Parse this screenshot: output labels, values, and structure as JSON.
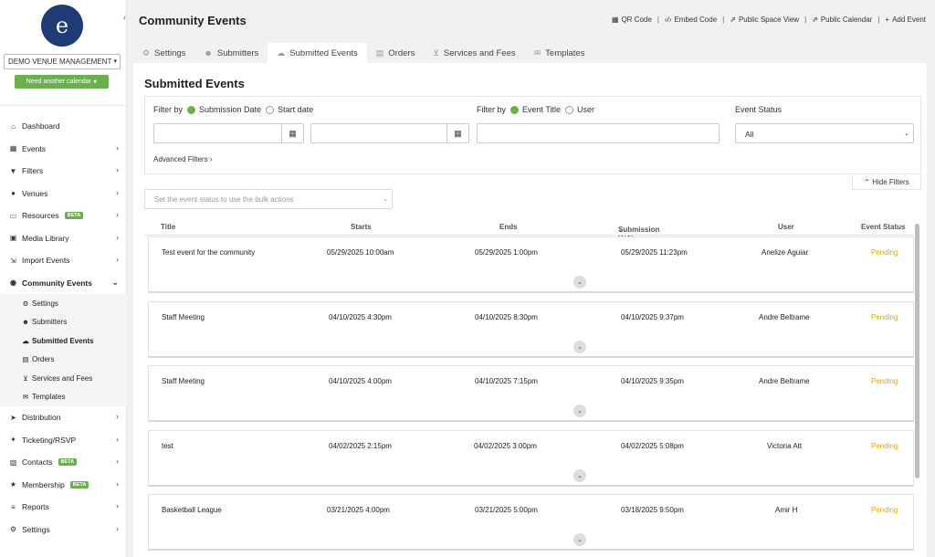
{
  "sidebar": {
    "logo_glyph": "e",
    "venue_select": "DEMO VENUE MANAGEMENT",
    "need_calendar": "Need another calendar",
    "items": [
      {
        "label": "Dashboard",
        "icon": "home-icon",
        "glyph": "⌂"
      },
      {
        "label": "Events",
        "icon": "calendar-icon",
        "glyph": "▦"
      },
      {
        "label": "Filters",
        "icon": "filter-icon",
        "glyph": "▼"
      },
      {
        "label": "Venues",
        "icon": "map-pin-icon",
        "glyph": "●"
      },
      {
        "label": "Resources",
        "icon": "monitor-icon",
        "glyph": "▭",
        "badge": "BETA"
      },
      {
        "label": "Media Library",
        "icon": "image-icon",
        "glyph": "▣"
      },
      {
        "label": "Import Events",
        "icon": "import-icon",
        "glyph": "⇲"
      },
      {
        "label": "Community Events",
        "icon": "globe-icon",
        "glyph": "◉"
      }
    ],
    "sub_items": [
      {
        "label": "Settings",
        "icon": "gear-icon",
        "glyph": "⚙"
      },
      {
        "label": "Submitters",
        "icon": "users-icon",
        "glyph": "☻"
      },
      {
        "label": "Submitted Events",
        "icon": "cloud-upload-icon",
        "glyph": "☁"
      },
      {
        "label": "Orders",
        "icon": "file-icon",
        "glyph": "▤"
      },
      {
        "label": "Services and Fees",
        "icon": "cart-icon",
        "glyph": "⊻"
      },
      {
        "label": "Templates",
        "icon": "envelope-icon",
        "glyph": "✉"
      }
    ],
    "items_bottom": [
      {
        "label": "Distribution",
        "icon": "send-icon",
        "glyph": "➤"
      },
      {
        "label": "Ticketing/RSVP",
        "icon": "ticket-icon",
        "glyph": "✦"
      },
      {
        "label": "Contacts",
        "icon": "address-card-icon",
        "glyph": "▧",
        "badge": "BETA"
      },
      {
        "label": "Membership",
        "icon": "star-icon",
        "glyph": "★",
        "badge": "BETA"
      },
      {
        "label": "Reports",
        "icon": "list-icon",
        "glyph": "≡"
      },
      {
        "label": "Settings",
        "icon": "gears-icon",
        "glyph": "⚙"
      }
    ]
  },
  "header": {
    "title": "Community Events",
    "links": [
      "QR Code",
      "Embed Code",
      "Public Space View",
      "Public Calendar",
      "Add Event"
    ]
  },
  "tabs": [
    {
      "label": "Settings",
      "icon": "gear-icon",
      "glyph": "⚙"
    },
    {
      "label": "Submitters",
      "icon": "users-icon",
      "glyph": "☻"
    },
    {
      "label": "Submitted Events",
      "icon": "cloud-upload-icon",
      "glyph": "☁"
    },
    {
      "label": "Orders",
      "icon": "file-icon",
      "glyph": "▤"
    },
    {
      "label": "Services and Fees",
      "icon": "cart-icon",
      "glyph": "⊻"
    },
    {
      "label": "Templates",
      "icon": "envelope-icon",
      "glyph": "✉"
    }
  ],
  "main": {
    "section_title": "Submitted Events",
    "filter_by_1": "Filter by",
    "radio_submission": "Submission Date",
    "radio_start": "Start date",
    "filter_by_2": "Filter by",
    "radio_title": "Event Title",
    "radio_user": "User",
    "status_label": "Event Status",
    "status_value": "All",
    "advanced": "Advanced Filters",
    "hide_filters": "Hide Filters",
    "bulk_placeholder": "Set the event status to use the bulk actions",
    "columns": [
      "Title",
      "Starts",
      "Ends",
      "Submission Date",
      "User",
      "Event Status"
    ],
    "rows": [
      {
        "title": "Test event for the community",
        "starts": "05/29/2025 10:00am",
        "ends": "05/29/2025 1:00pm",
        "submitted": "05/29/2025 11:23pm",
        "user": "Anelize Aguiar",
        "status": "Pending"
      },
      {
        "title": "Staff Meeting",
        "starts": "04/10/2025 4:30pm",
        "ends": "04/10/2025 8:30pm",
        "submitted": "04/10/2025 9:37pm",
        "user": "Andre Beltrame",
        "status": "Pending"
      },
      {
        "title": "Staff Meeting",
        "starts": "04/10/2025 4:00pm",
        "ends": "04/10/2025 7:15pm",
        "submitted": "04/10/2025 9:35pm",
        "user": "Andre Beltrame",
        "status": "Pending"
      },
      {
        "title": "test",
        "starts": "04/02/2025 2:15pm",
        "ends": "04/02/2025 3:00pm",
        "submitted": "04/02/2025 5:08pm",
        "user": "Victoria Att",
        "status": "Pending"
      },
      {
        "title": "Basketball League",
        "starts": "03/21/2025 4:00pm",
        "ends": "03/21/2025 5:00pm",
        "submitted": "03/18/2025 9:50pm",
        "user": "Amir H",
        "status": "Pending"
      }
    ]
  },
  "colors": {
    "accent_green": "#6ab04c",
    "logo_navy": "#1f3b73",
    "pending": "#e0a800"
  }
}
